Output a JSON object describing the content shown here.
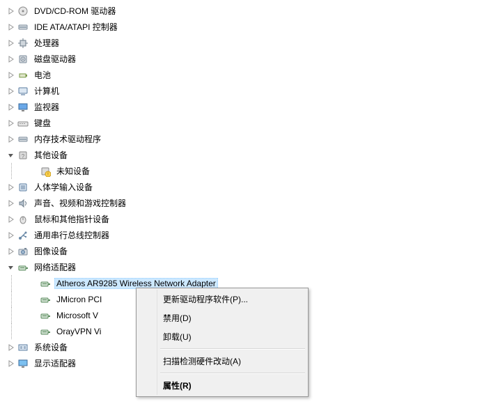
{
  "tree": [
    {
      "id": "dvd",
      "level": 1,
      "expander": "closed",
      "icon": "disc",
      "label": "DVD/CD-ROM 驱动器"
    },
    {
      "id": "ide",
      "level": 1,
      "expander": "closed",
      "icon": "ide",
      "label": "IDE ATA/ATAPI 控制器"
    },
    {
      "id": "cpu",
      "level": 1,
      "expander": "closed",
      "icon": "cpu",
      "label": "处理器"
    },
    {
      "id": "disk",
      "level": 1,
      "expander": "closed",
      "icon": "disk",
      "label": "磁盘驱动器"
    },
    {
      "id": "battery",
      "level": 1,
      "expander": "closed",
      "icon": "battery",
      "label": "电池"
    },
    {
      "id": "computer",
      "level": 1,
      "expander": "closed",
      "icon": "computer",
      "label": "计算机"
    },
    {
      "id": "monitor",
      "level": 1,
      "expander": "closed",
      "icon": "monitor",
      "label": "监视器"
    },
    {
      "id": "keyboard",
      "level": 1,
      "expander": "closed",
      "icon": "keyboard",
      "label": "键盘"
    },
    {
      "id": "memtech",
      "level": 1,
      "expander": "closed",
      "icon": "ide",
      "label": "内存技术驱动程序"
    },
    {
      "id": "other",
      "level": 1,
      "expander": "open",
      "icon": "other",
      "label": "其他设备"
    },
    {
      "id": "unknown",
      "level": 2,
      "expander": "none",
      "icon": "unknown",
      "label": "未知设备",
      "lastChild": true
    },
    {
      "id": "hid",
      "level": 1,
      "expander": "closed",
      "icon": "hid",
      "label": "人体学输入设备"
    },
    {
      "id": "sound",
      "level": 1,
      "expander": "closed",
      "icon": "sound",
      "label": "声音、视频和游戏控制器"
    },
    {
      "id": "mouse",
      "level": 1,
      "expander": "closed",
      "icon": "mouse",
      "label": "鼠标和其他指针设备"
    },
    {
      "id": "usb",
      "level": 1,
      "expander": "closed",
      "icon": "usb",
      "label": "通用串行总线控制器"
    },
    {
      "id": "imaging",
      "level": 1,
      "expander": "closed",
      "icon": "imaging",
      "label": "图像设备"
    },
    {
      "id": "network",
      "level": 1,
      "expander": "open",
      "icon": "network",
      "label": "网络适配器"
    },
    {
      "id": "atheros",
      "level": 2,
      "expander": "none",
      "icon": "network",
      "label": "Atheros AR9285 Wireless Network Adapter",
      "selected": true
    },
    {
      "id": "jmicron",
      "level": 2,
      "expander": "none",
      "icon": "network",
      "label": "JMicron PCI"
    },
    {
      "id": "msvirtual",
      "level": 2,
      "expander": "none",
      "icon": "network",
      "label": "Microsoft V"
    },
    {
      "id": "orayvpn",
      "level": 2,
      "expander": "none",
      "icon": "network",
      "label": "OrayVPN Vi",
      "lastChild": true
    },
    {
      "id": "system",
      "level": 1,
      "expander": "closed",
      "icon": "system",
      "label": "系统设备"
    },
    {
      "id": "display",
      "level": 1,
      "expander": "closed",
      "icon": "display",
      "label": "显示适配器"
    }
  ],
  "contextMenu": {
    "items": [
      {
        "id": "update",
        "label": "更新驱动程序软件(P)..."
      },
      {
        "id": "disable",
        "label": "禁用(D)"
      },
      {
        "id": "uninstall",
        "label": "卸载(U)"
      },
      {
        "sep": true
      },
      {
        "id": "scan",
        "label": "扫描检测硬件改动(A)"
      },
      {
        "sep": true
      },
      {
        "id": "props",
        "label": "属性(R)",
        "bold": true
      }
    ]
  }
}
